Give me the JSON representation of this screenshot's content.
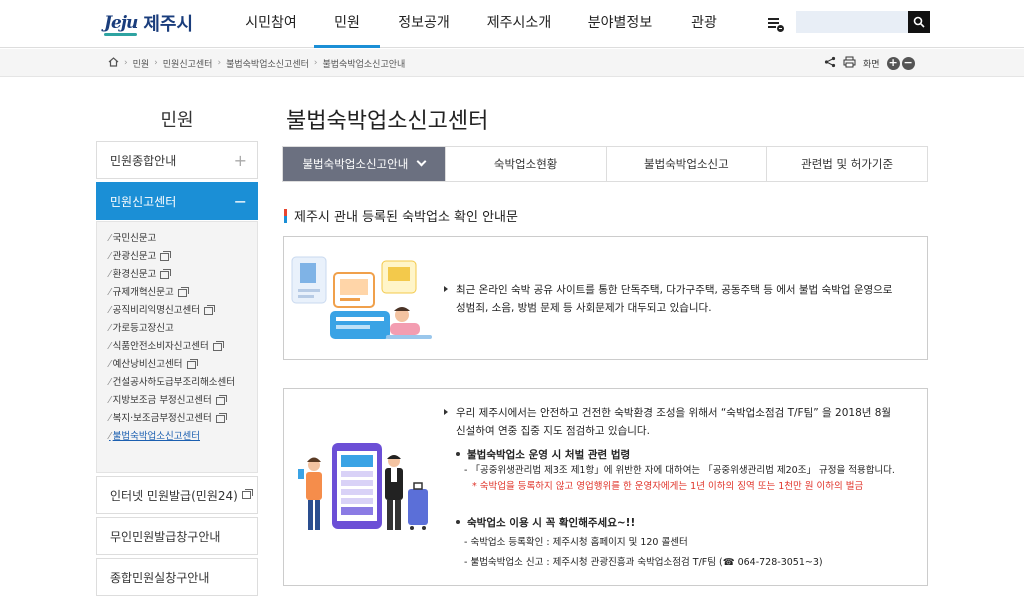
{
  "header": {
    "logo_en": "Jeju",
    "logo_ko": "제주시",
    "menu": [
      {
        "label": "시민참여"
      },
      {
        "label": "민원"
      },
      {
        "label": "정보공개"
      },
      {
        "label": "제주시소개"
      },
      {
        "label": "분야별정보"
      },
      {
        "label": "관광"
      }
    ],
    "active_menu": "민원",
    "search_placeholder": ""
  },
  "breadcrumb": [
    "민원",
    "민원신고센터",
    "불법숙박업소신고센터",
    "불법숙박업소신고안내"
  ],
  "tools": {
    "screen_label": "화면",
    "zoom_in": "+",
    "zoom_out": "−"
  },
  "sidebar": {
    "title": "민원",
    "top_items": [
      {
        "label": "민원종합안내",
        "sign": "+"
      },
      {
        "label": "민원신고센터",
        "sign": "−"
      }
    ],
    "sub_items": [
      {
        "label": "국민신문고"
      },
      {
        "label": "관광신문고"
      },
      {
        "label": "환경신문고"
      },
      {
        "label": "규제개혁신문고"
      },
      {
        "label": "공직비리익명신고센터"
      },
      {
        "label": "가로등고장신고"
      },
      {
        "label": "식품안전소비자신고센터"
      },
      {
        "label": "예산낭비신고센터"
      },
      {
        "label": "건설공사하도급부조리해소센터"
      },
      {
        "label": "지방보조금 부정신고센터"
      },
      {
        "label": "복지·보조금부정신고센터"
      },
      {
        "label": "불법숙박업소신고센터"
      }
    ],
    "bottom_items": [
      {
        "label": "인터넷 민원발급(민원24)"
      },
      {
        "label": "무인민원발급창구안내"
      },
      {
        "label": "종합민원실창구안내"
      }
    ]
  },
  "content": {
    "title": "불법숙박업소신고센터",
    "tabs": [
      {
        "label": "불법숙박업소신고안내"
      },
      {
        "label": "숙박업소현황"
      },
      {
        "label": "불법숙박업소신고"
      },
      {
        "label": "관련법 및 허가기준"
      }
    ],
    "section_heading": "제주시 관내 등록된 숙박업소 확인 안내문",
    "box1_text_1": "최근 온라인 숙박 공유 사이트를 통한 단독주택, 다가구주택, 공동주택 등 에서 불법 숙박업 운영으로",
    "box1_text_2": "성범죄, 소음, 방범 문제 등 사회문제가 대두되고 있습니다.",
    "box2_intro_1": "우리 제주시에서는 안전하고 건전한 숙박환경 조성을 위해서 “숙박업소점검 T/F팀” 을 2018년 8월",
    "box2_intro_2": "신설하여 연중 집중 지도 점검하고 있습니다.",
    "law_heading": "불법숙박업소 운영 시 처벌 관련 법령",
    "law_line": "- 「공중위생관리법 제3조 제1항」에 위반한 자에 대하여는 「공중위생관리법 제20조」 규정을 적용합니다.",
    "law_note": "* 숙박업을 등록하지 않고 영업행위를 한 운영자에게는 1년 이하의 징역 또는 1천만 원 이하의 벌금",
    "check_heading": "숙박업소 이용 시 꼭 확인해주세요~!!",
    "check_line_1": "- 숙박업소 등록확인 : 제주시청 홈페이지 및 120 콜센터",
    "check_line_2": "- 불법숙박업소 신고 : 제주시청 관광진흥과 숙박업소점검 T/F팀 (☎ 064-728-3051~3)"
  },
  "colors": {
    "accent": "#1b8fd6",
    "tab_active": "#6b7080",
    "warning": "#e0342a",
    "brand": "#1a3d7c"
  }
}
